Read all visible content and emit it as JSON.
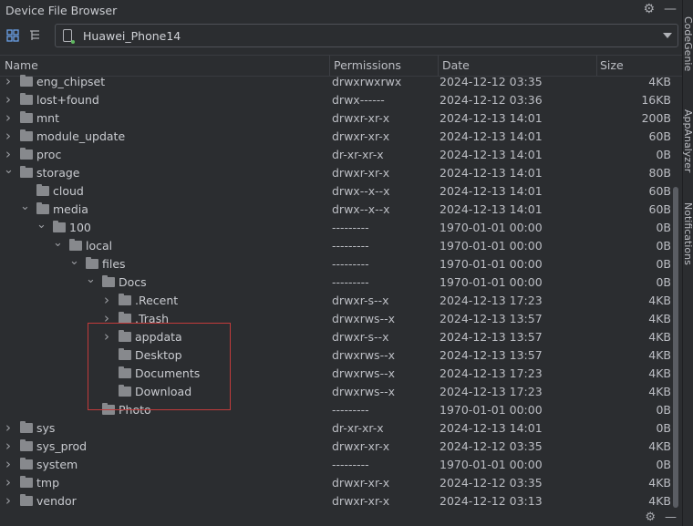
{
  "window": {
    "title": "Device File Browser"
  },
  "device": {
    "name": "Huawei_Phone14"
  },
  "columns": {
    "name": "Name",
    "permissions": "Permissions",
    "date": "Date",
    "size": "Size"
  },
  "side_tabs": [
    "CodeGenie",
    "AppAnalyzer",
    "Notifications"
  ],
  "rows": [
    {
      "name": "eng_chipset",
      "depth": 0,
      "chevron": "right",
      "permissions": "drwxrwxrwx",
      "date": "2024-12-12 03:35",
      "size": "4KB"
    },
    {
      "name": "lost+found",
      "depth": 0,
      "chevron": "right",
      "permissions": "drwx------",
      "date": "2024-12-12 03:36",
      "size": "16KB"
    },
    {
      "name": "mnt",
      "depth": 0,
      "chevron": "right",
      "permissions": "drwxr-xr-x",
      "date": "2024-12-13 14:01",
      "size": "200B"
    },
    {
      "name": "module_update",
      "depth": 0,
      "chevron": "right",
      "permissions": "drwxr-xr-x",
      "date": "2024-12-13 14:01",
      "size": "60B"
    },
    {
      "name": "proc",
      "depth": 0,
      "chevron": "right",
      "permissions": "dr-xr-xr-x",
      "date": "2024-12-13 14:01",
      "size": "0B"
    },
    {
      "name": "storage",
      "depth": 0,
      "chevron": "down",
      "permissions": "drwxr-xr-x",
      "date": "2024-12-13 14:01",
      "size": "80B"
    },
    {
      "name": "cloud",
      "depth": 1,
      "chevron": "none",
      "permissions": "drwx--x--x",
      "date": "2024-12-13 14:01",
      "size": "60B"
    },
    {
      "name": "media",
      "depth": 1,
      "chevron": "down",
      "permissions": "drwx--x--x",
      "date": "2024-12-13 14:01",
      "size": "60B"
    },
    {
      "name": "100",
      "depth": 2,
      "chevron": "down",
      "permissions": "---------",
      "date": "1970-01-01 00:00",
      "size": "0B"
    },
    {
      "name": "local",
      "depth": 3,
      "chevron": "down",
      "permissions": "---------",
      "date": "1970-01-01 00:00",
      "size": "0B"
    },
    {
      "name": "files",
      "depth": 4,
      "chevron": "down",
      "permissions": "---------",
      "date": "1970-01-01 00:00",
      "size": "0B"
    },
    {
      "name": "Docs",
      "depth": 5,
      "chevron": "down",
      "permissions": "---------",
      "date": "1970-01-01 00:00",
      "size": "0B"
    },
    {
      "name": ".Recent",
      "depth": 6,
      "chevron": "right",
      "permissions": "drwxr-s--x",
      "date": "2024-12-13 17:23",
      "size": "4KB"
    },
    {
      "name": ".Trash",
      "depth": 6,
      "chevron": "right",
      "permissions": "drwxrws--x",
      "date": "2024-12-13 13:57",
      "size": "4KB"
    },
    {
      "name": "appdata",
      "depth": 6,
      "chevron": "right",
      "permissions": "drwxr-s--x",
      "date": "2024-12-13 13:57",
      "size": "4KB"
    },
    {
      "name": "Desktop",
      "depth": 6,
      "chevron": "none",
      "permissions": "drwxrws--x",
      "date": "2024-12-13 13:57",
      "size": "4KB"
    },
    {
      "name": "Documents",
      "depth": 6,
      "chevron": "none",
      "permissions": "drwxrws--x",
      "date": "2024-12-13 17:23",
      "size": "4KB"
    },
    {
      "name": "Download",
      "depth": 6,
      "chevron": "none",
      "permissions": "drwxrws--x",
      "date": "2024-12-13 17:23",
      "size": "4KB"
    },
    {
      "name": "Photo",
      "depth": 5,
      "chevron": "none",
      "permissions": "---------",
      "date": "1970-01-01 00:00",
      "size": "0B"
    },
    {
      "name": "sys",
      "depth": 0,
      "chevron": "right",
      "permissions": "dr-xr-xr-x",
      "date": "2024-12-13 14:01",
      "size": "0B"
    },
    {
      "name": "sys_prod",
      "depth": 0,
      "chevron": "right",
      "permissions": "drwxr-xr-x",
      "date": "2024-12-12 03:35",
      "size": "4KB"
    },
    {
      "name": "system",
      "depth": 0,
      "chevron": "right",
      "permissions": "---------",
      "date": "1970-01-01 00:00",
      "size": "0B"
    },
    {
      "name": "tmp",
      "depth": 0,
      "chevron": "right",
      "permissions": "drwxr-xr-x",
      "date": "2024-12-12 03:35",
      "size": "4KB"
    },
    {
      "name": "vendor",
      "depth": 0,
      "chevron": "right",
      "permissions": "drwxr-xr-x",
      "date": "2024-12-12 03:13",
      "size": "4KB"
    }
  ],
  "icons": {
    "settings": "gear-icon",
    "minimize": "minimize-icon",
    "flatten": "flatten-view-icon",
    "tree": "tree-view-icon",
    "device": "phone-icon"
  }
}
